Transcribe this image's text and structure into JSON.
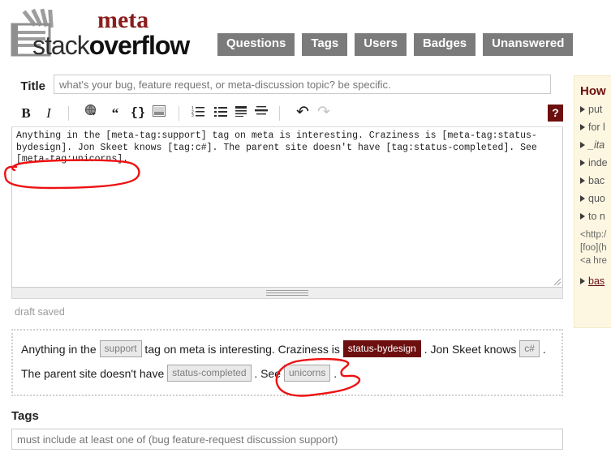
{
  "header": {
    "logo": {
      "meta": "meta",
      "stack": "stack",
      "overflow": "overflow",
      "icon": "stackoverflow-logo-icon"
    },
    "nav": [
      {
        "label": "Questions",
        "name": "nav-questions"
      },
      {
        "label": "Tags",
        "name": "nav-tags"
      },
      {
        "label": "Users",
        "name": "nav-users"
      },
      {
        "label": "Badges",
        "name": "nav-badges"
      },
      {
        "label": "Unanswered",
        "name": "nav-unanswered"
      }
    ]
  },
  "form": {
    "title_label": "Title",
    "title_value": "",
    "title_placeholder": "what's your bug, feature request, or meta-discussion topic? be specific.",
    "body_markdown": "Anything in the [meta-tag:support] tag on meta is interesting. Craziness is [meta-tag:status-bydesign]. Jon Skeet knows [tag:c#]. The parent site doesn't have [tag:status-completed]. See [meta-tag:unicorns].",
    "draft_status": "draft saved",
    "tags_label": "Tags",
    "tags_value": "",
    "tags_placeholder": "must include at least one of (bug feature-request discussion support)"
  },
  "toolbar": {
    "bold": "B",
    "italic": "I",
    "link": "link-icon",
    "quote": "“",
    "code": "{}",
    "image": "image-icon",
    "numbered_list": "numbered-list-icon",
    "bullet_list": "bullet-list-icon",
    "heading": "heading-icon",
    "horizontal_rule": "horizontal-rule-icon",
    "undo": "↶",
    "redo": "↷",
    "help": "?"
  },
  "preview": {
    "line1": [
      {
        "type": "text",
        "value": "Anything in the "
      },
      {
        "type": "chip",
        "value": "support",
        "style": "plain"
      },
      {
        "type": "text",
        "value": " tag on meta is interesting. Craziness is "
      },
      {
        "type": "chip",
        "value": "status-bydesign",
        "style": "hot"
      },
      {
        "type": "text",
        "value": " . Jon Skeet knows "
      },
      {
        "type": "chip",
        "value": "c#",
        "style": "plain"
      },
      {
        "type": "text",
        "value": " ."
      }
    ],
    "line2": [
      {
        "type": "text",
        "value": "The parent site doesn't have "
      },
      {
        "type": "chip",
        "value": "status-completed",
        "style": "plain"
      },
      {
        "type": "text",
        "value": " . See "
      },
      {
        "type": "chip",
        "value": "unicorns",
        "style": "plain"
      },
      {
        "type": "text",
        "value": " ."
      }
    ]
  },
  "sidebar": {
    "title": "How",
    "items": [
      {
        "label": "put",
        "kind": "bullet"
      },
      {
        "label": "for l",
        "kind": "bullet"
      },
      {
        "label": "_ita",
        "kind": "bullet-italic"
      },
      {
        "label": "inde",
        "kind": "bullet"
      },
      {
        "label": "bac",
        "kind": "bullet"
      },
      {
        "label": "quo",
        "kind": "bullet"
      },
      {
        "label": "to n",
        "kind": "bullet"
      }
    ],
    "code_lines": [
      "<http:/",
      "[foo](h",
      "<a hre"
    ],
    "footer_link": "bas"
  },
  "colors": {
    "accent_maroon": "#6d0f0f",
    "nav_gray": "#7b7b7b",
    "annotation_red": "#ee1111",
    "sidebar_cream": "#fdf7e2",
    "chip_gray": "#e9e9e9"
  },
  "annotations": [
    {
      "name": "circle-around-meta-tag-unicorns-source",
      "color": "#ee1111"
    },
    {
      "name": "circle-around-unicorns-chip-preview",
      "color": "#ee1111"
    }
  ]
}
